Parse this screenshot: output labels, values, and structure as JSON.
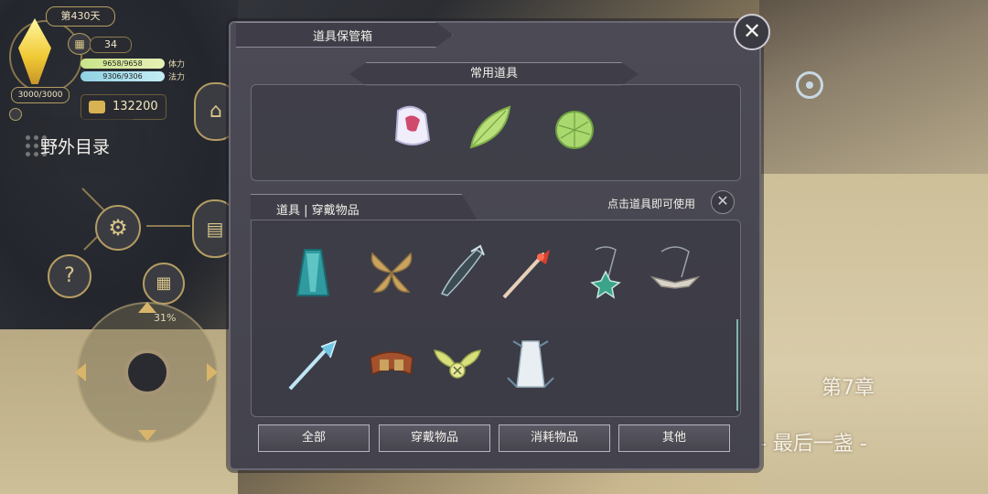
{
  "hud": {
    "day": "第430天",
    "calendar_count": "34",
    "hp_text": "3000/3000",
    "stamina": {
      "value": "9658/9658",
      "label": "体力",
      "fraction": 1.0
    },
    "mana": {
      "value": "9306/9306",
      "label": "法力",
      "fraction": 1.0
    },
    "gold": "132200",
    "wild_catalog": "野外目录",
    "help_icon_glyph": "?",
    "joystick_percent": "31%"
  },
  "modal": {
    "title": "道具保管箱",
    "close_glyph": "✕",
    "common_section": "常用道具",
    "gear_tab": "道具 | 穿戴物品",
    "hint": "点击道具即可使用",
    "hint_close_glyph": "✕",
    "filter_tabs": [
      "全部",
      "穿戴物品",
      "消耗物品",
      "其他"
    ]
  },
  "story": {
    "chapter": "第7章",
    "subtitle": "- 最后一盏 -"
  },
  "icons": {
    "common_items": [
      "hood-icon",
      "green-leaf-icon",
      "round-leaf-icon"
    ],
    "gear_items": [
      "teal-cloak-icon",
      "leaf-wings-icon",
      "dark-blade-icon",
      "flame-sword-icon",
      "star-pendant-icon",
      "wing-necklace-icon",
      "ice-sword-icon",
      "belt-pouch-icon",
      "fairy-wings-icon",
      "white-dress-icon"
    ]
  }
}
